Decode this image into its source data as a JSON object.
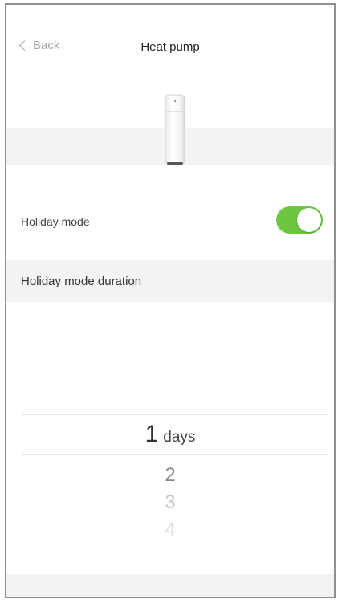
{
  "nav": {
    "back_label": "Back",
    "title": "Heat pump"
  },
  "holiday_mode": {
    "label": "Holiday mode",
    "enabled": true,
    "toggle_color": "#6cc63f"
  },
  "duration": {
    "label": "Holiday mode duration"
  },
  "picker": {
    "selected_value": "1",
    "unit": "days",
    "options": [
      "2",
      "3",
      "4"
    ]
  }
}
